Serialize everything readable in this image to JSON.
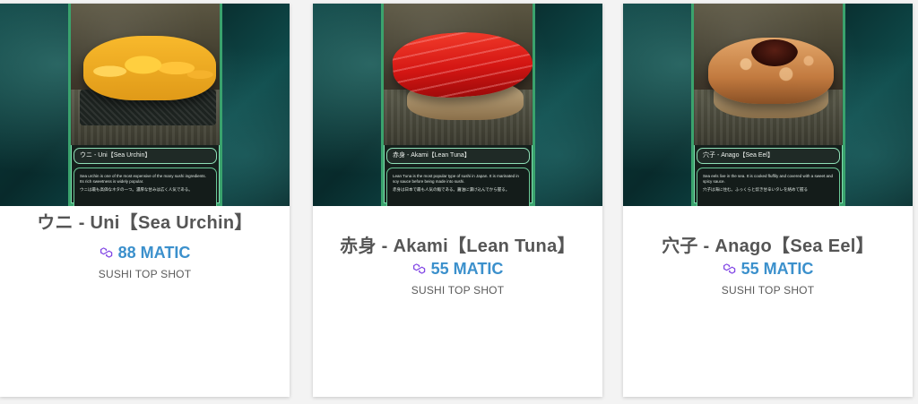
{
  "cards": [
    {
      "title": "赤身 - Akami【Lean Tuna】",
      "price": "55 MATIC",
      "collection": "SUSHI TOP SHOT",
      "art": {
        "label": "赤身 - Akami【Lean Tuna】",
        "desc_en": "Lean Tuna is the most popular type of sushi in Japan. It is marinated in soy sauce before being made into sushi.",
        "desc_jp": "赤身は日本で最も人気の鮨である。醤油に漬け込んでから握る。"
      }
    },
    {
      "title": "穴子 - Anago【Sea Eel】",
      "price": "55 MATIC",
      "collection": "SUSHI TOP SHOT",
      "art": {
        "label": "穴子 - Anago【Sea Eel】",
        "desc_en": "Sea eels live in the sea. It is cooked fluffily and covered with a sweet and spicy sauce.",
        "desc_jp": "穴子は海に住む。ふっくらと炊き甘辛いタレを絡めて握る"
      }
    },
    {
      "title": "ウニ - Uni【Sea Urchin】",
      "price": "88 MATIC",
      "collection": "SUSHI TOP SHOT",
      "art": {
        "label": "ウニ - Uni【Sea Urchin】",
        "desc_en": "Sea urchin is one of the most expensive of the many sushi ingredients. Its rich sweetness is widely popular.",
        "desc_jp": "ウニは最も高価なネタの一つ。濃厚な甘みは広く人気である。"
      }
    }
  ],
  "colors": {
    "price": "#3b90cc",
    "matic_icon": "#8247e5",
    "title": "#555555",
    "frame": "#3aa36d"
  },
  "icons": {
    "price_icon": "polygon-matic-icon"
  }
}
